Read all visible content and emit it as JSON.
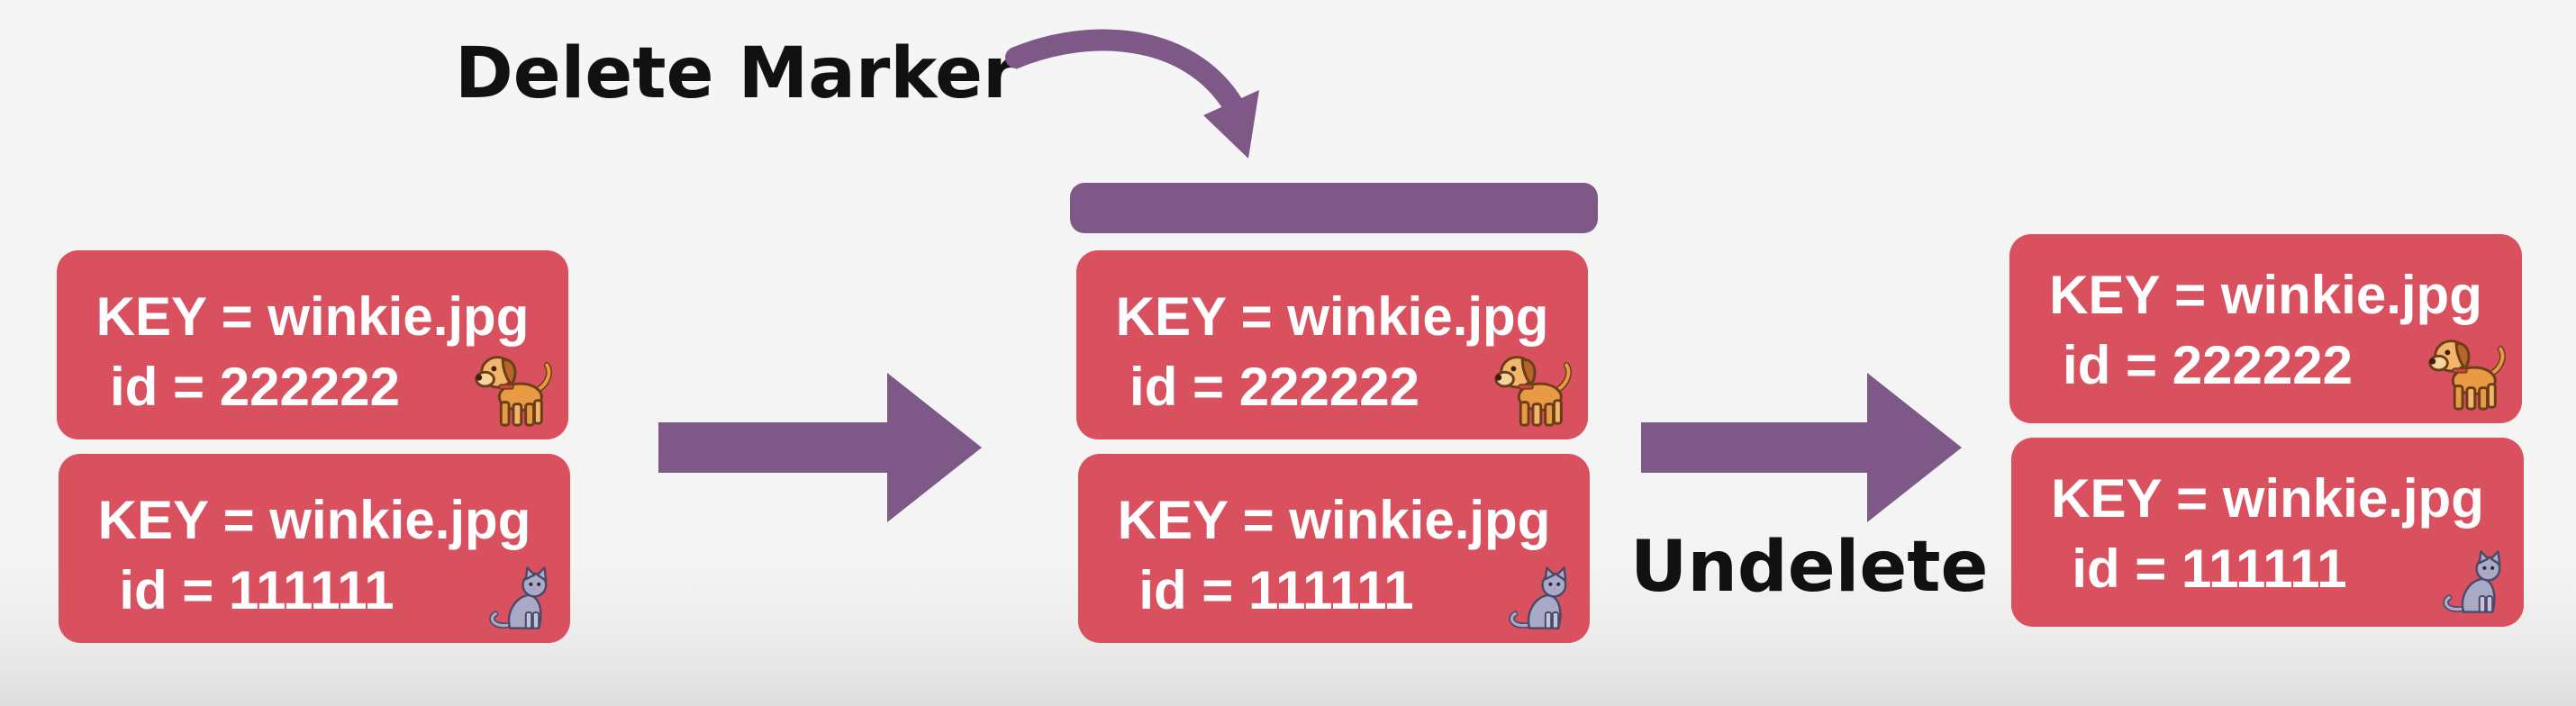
{
  "labels": {
    "delete_marker": "Delete Marker",
    "undelete": "Undelete"
  },
  "stages": [
    {
      "versions": [
        {
          "key": "KEY = winkie.jpg",
          "id": "id = 222222",
          "icon": "dog-icon"
        },
        {
          "key": "KEY = winkie.jpg",
          "id": "id = 111111",
          "icon": "cat-icon"
        }
      ]
    },
    {
      "delete_marker": true,
      "versions": [
        {
          "key": "KEY = winkie.jpg",
          "id": "id = 222222",
          "icon": "dog-icon"
        },
        {
          "key": "KEY = winkie.jpg",
          "id": "id = 111111",
          "icon": "cat-icon"
        }
      ]
    },
    {
      "versions": [
        {
          "key": "KEY = winkie.jpg",
          "id": "id = 222222",
          "icon": "dog-icon"
        },
        {
          "key": "KEY = winkie.jpg",
          "id": "id = 111111",
          "icon": "cat-icon"
        }
      ]
    }
  ],
  "colors": {
    "card": "#d9505f",
    "accent_purple": "#7e5988",
    "text_light": "#ffffff",
    "text_dark": "#111111",
    "background": "#f5f5f5"
  }
}
